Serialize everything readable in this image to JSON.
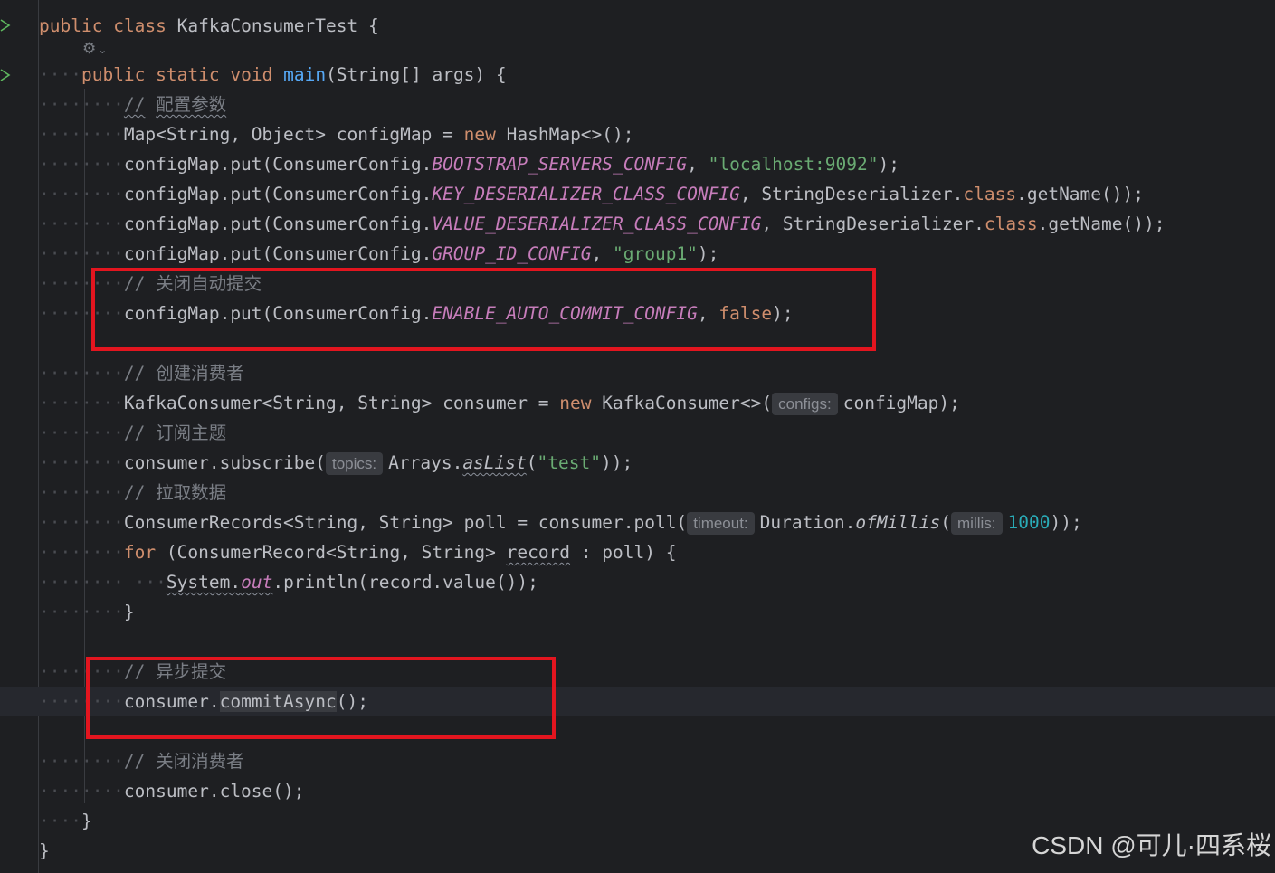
{
  "code": {
    "class_decl": {
      "kw1": "public",
      "kw2": "class",
      "name": "KafkaConsumerTest",
      "brace": "{"
    },
    "method_decl": {
      "kw1": "public",
      "kw2": "static",
      "kw3": "void",
      "name": "main",
      "params": "(String[] args)",
      "brace": "{"
    },
    "c_config": "配置参数",
    "map_decl": {
      "type": "Map<String, Object> configMap",
      "eq": "=",
      "kw": "new",
      "rest": "HashMap<>();"
    },
    "put1": {
      "pre": "configMap.put(ConsumerConfig.",
      "const": "BOOTSTRAP_SERVERS_CONFIG",
      "sep": ",",
      "str": "\"localhost:9092\"",
      "end": ");"
    },
    "put2": {
      "pre": "configMap.put(ConsumerConfig.",
      "const": "KEY_DESERIALIZER_CLASS_CONFIG",
      "mid": ", StringDeserializer.",
      "kw": "class",
      "end": ".getName());"
    },
    "put3": {
      "pre": "configMap.put(ConsumerConfig.",
      "const": "VALUE_DESERIALIZER_CLASS_CONFIG",
      "mid": ", StringDeserializer.",
      "kw": "class",
      "end": ".getName());"
    },
    "put4": {
      "pre": "configMap.put(ConsumerConfig.",
      "const": "GROUP_ID_CONFIG",
      "sep": ",",
      "str": "\"group1\"",
      "end": ");"
    },
    "c_disable_auto": "关闭自动提交",
    "put5": {
      "pre": "configMap.put(ConsumerConfig.",
      "const": "ENABLE_AUTO_COMMIT_CONFIG",
      "sep": ",",
      "kw": "false",
      "end": ");"
    },
    "c_create": "创建消费者",
    "consumer_decl": {
      "pre": "KafkaConsumer<String, String> consumer",
      "eq": "=",
      "kw": "new",
      "ctor": "KafkaConsumer<>(",
      "hint": "configs:",
      "end": "configMap);"
    },
    "c_subscribe": "订阅主题",
    "subscribe": {
      "pre": "consumer.subscribe(",
      "hint": "topics:",
      "obj": "Arrays.",
      "method": "asList",
      "open": "(",
      "str": "\"test\"",
      "end": "));"
    },
    "c_pull": "拉取数据",
    "poll": {
      "pre": "ConsumerRecords<String, String> poll",
      "eq": "=",
      "call": "consumer.poll(",
      "hint1": "timeout:",
      "obj": "Duration.",
      "method": "ofMillis",
      "open": "(",
      "hint2": "millis:",
      "num": "1000",
      "end": "));"
    },
    "for_line": {
      "kw": "for",
      "mid": "(ConsumerRecord<String, String>",
      "var": "record",
      "end": ": poll) {"
    },
    "println": {
      "cls": "System",
      "dot": ".",
      "field": "out",
      "end": ".println(record.value());"
    },
    "close_for": "}",
    "c_async": "异步提交",
    "commit": {
      "pre": "consumer.",
      "method": "commitAsync",
      "end": "();"
    },
    "c_close": "关闭消费者",
    "close": "consumer.close();",
    "close_method": "}",
    "close_class": "}",
    "comment_slash": "//"
  },
  "gear_icon": "⚙",
  "gear_chevron": "⌄",
  "run_icon": "run-arrow",
  "watermark": "CSDN @可儿·四系桜",
  "colors": {
    "background": "#1e1f22",
    "keyword": "#cf8e6d",
    "string": "#6aab73",
    "constant": "#c77dbb",
    "function": "#56a8f5",
    "comment": "#7a7e85",
    "highlight_box": "#e3151f"
  }
}
